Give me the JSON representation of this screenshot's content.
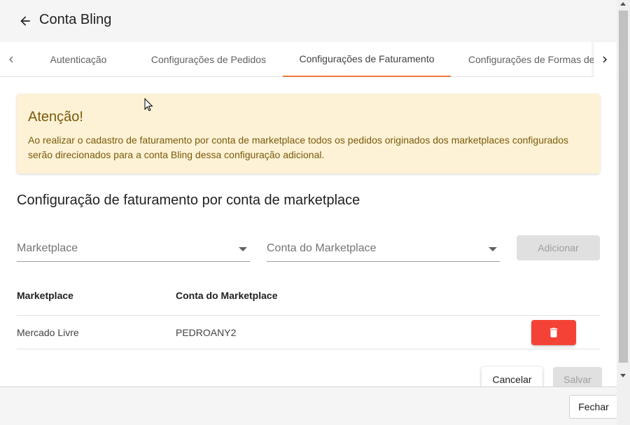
{
  "header": {
    "title": "Conta Bling"
  },
  "tabs": [
    {
      "label": "Autenticação"
    },
    {
      "label": "Configurações de Pedidos"
    },
    {
      "label": "Configurações de Faturamento",
      "active": true
    },
    {
      "label": "Configurações de Formas de"
    }
  ],
  "alert": {
    "title": "Atenção!",
    "message": "Ao realizar o cadastro de faturamento por conta de marketplace todos os pedidos originados dos marketplaces configurados serão direcionados para a conta Bling dessa configuração adicional."
  },
  "section": {
    "title": "Configuração de faturamento por conta de marketplace"
  },
  "form": {
    "marketplace_placeholder": "Marketplace",
    "account_placeholder": "Conta do Marketplace",
    "add_label": "Adicionar"
  },
  "table": {
    "headers": [
      "Marketplace",
      "Conta do Marketplace"
    ],
    "rows": [
      {
        "marketplace": "Mercado Livre",
        "account": "PEDROANY2"
      }
    ]
  },
  "actions": {
    "cancel_label": "Cancelar",
    "save_label": "Salvar"
  },
  "footer": {
    "close_label": "Fechar"
  },
  "colors": {
    "accent": "#f07a3a",
    "alert_bg": "#fdf2d5",
    "alert_text": "#7a5a0c",
    "danger": "#f44336"
  },
  "icons": {
    "back": "arrow-left-icon",
    "prev": "chevron-left-icon",
    "next": "chevron-right-icon",
    "delete": "trash-icon"
  }
}
